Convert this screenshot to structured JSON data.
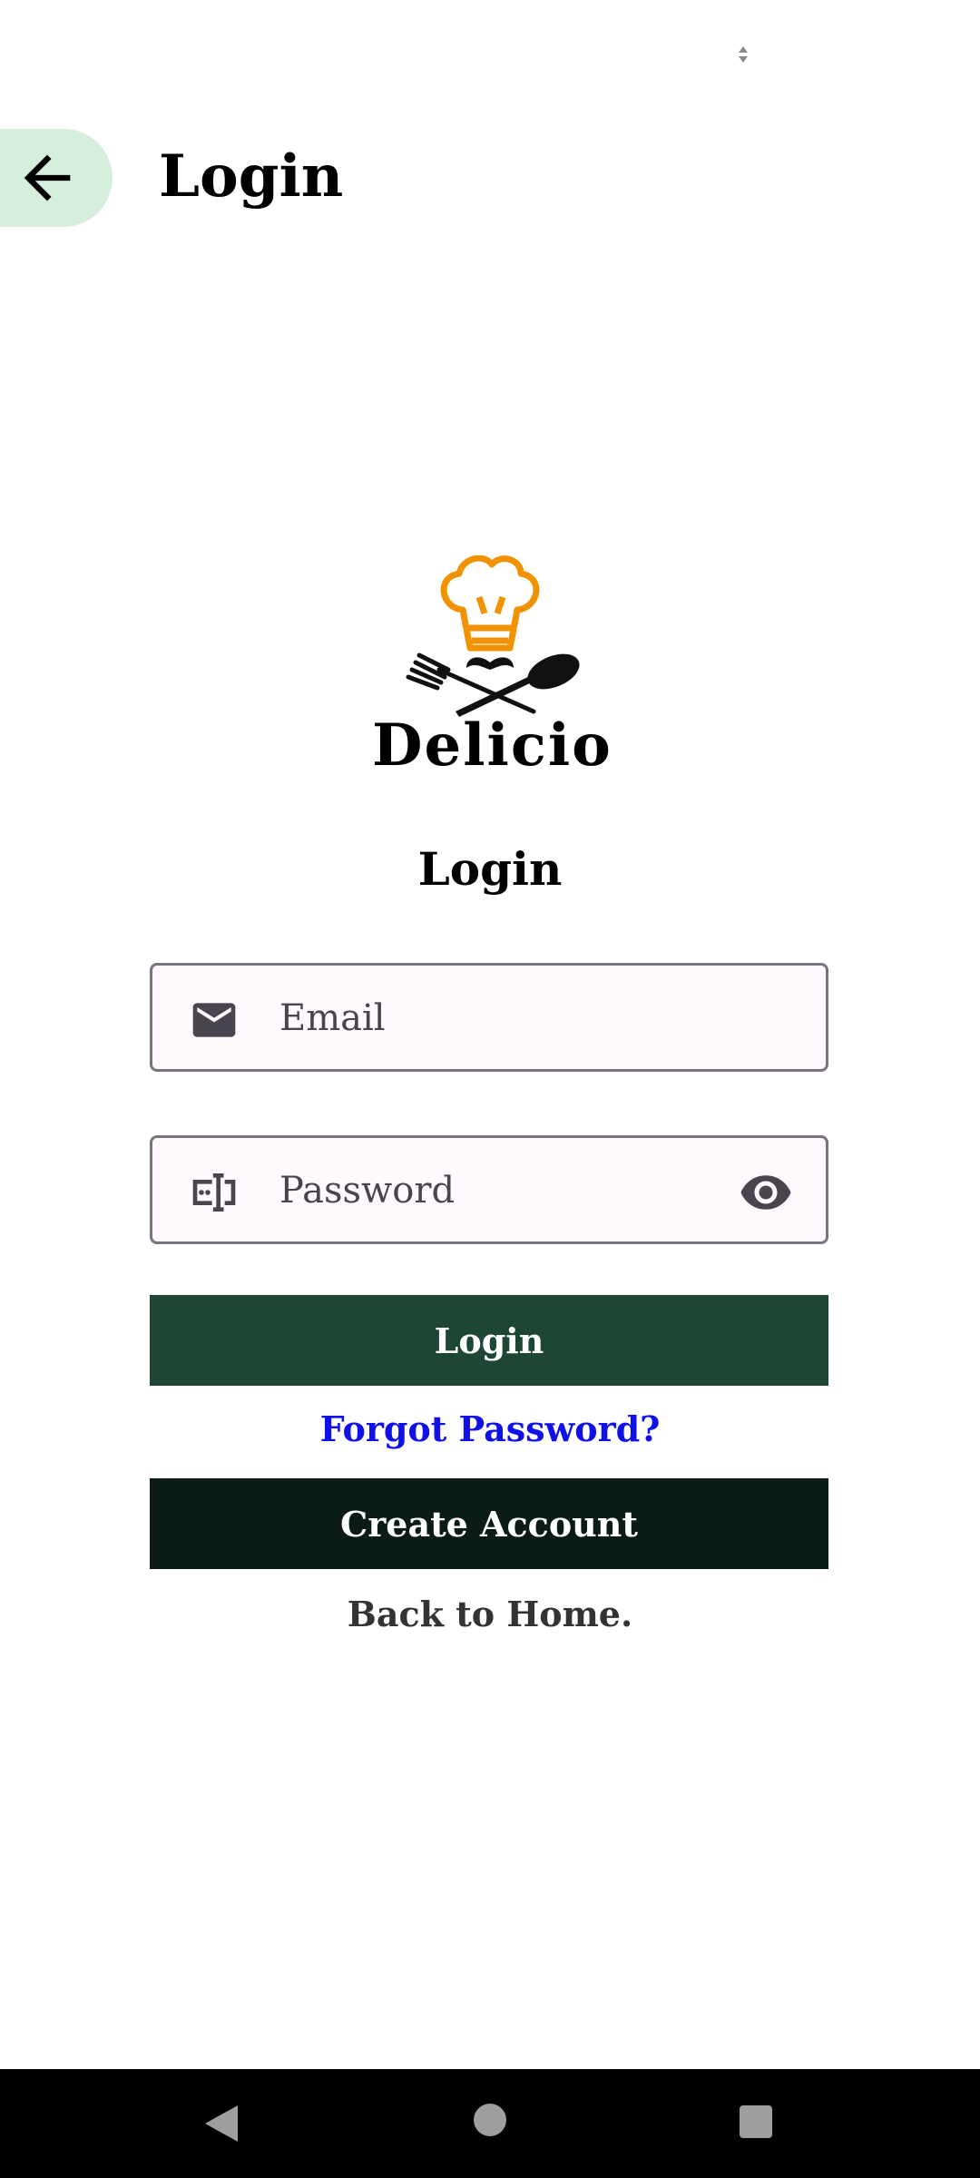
{
  "appbar": {
    "title": "Login",
    "back_icon": "arrow-left-icon"
  },
  "logo": {
    "wordmark": "Delicio",
    "icons": [
      "chef-hat-icon",
      "mustache-icon",
      "fork-icon",
      "spoon-icon"
    ],
    "hat_color": "#f39200"
  },
  "form": {
    "title": "Login",
    "email": {
      "placeholder": "Email",
      "value": "",
      "icon": "mail-icon"
    },
    "password": {
      "placeholder": "Password",
      "value": "",
      "icon": "password-icon",
      "toggle_icon": "eye-icon"
    },
    "login_label": "Login",
    "forgot_label": "Forgot Password?",
    "create_label": "Create Account",
    "home_label": "Back to Home."
  },
  "colors": {
    "back_button_bg": "#d5efdc",
    "field_bg": "#fff8fd",
    "login_button": "#1d4634",
    "create_button": "#0b1c16",
    "link_blue": "#1010e8"
  },
  "navbar": {
    "icons": [
      "nav-back-icon",
      "nav-home-icon",
      "nav-recents-icon"
    ]
  }
}
